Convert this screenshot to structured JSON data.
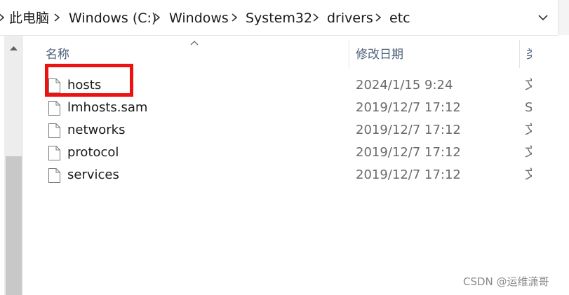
{
  "breadcrumb": [
    {
      "label": "此电脑"
    },
    {
      "label": "Windows (C:)"
    },
    {
      "label": "Windows"
    },
    {
      "label": "System32"
    },
    {
      "label": "drivers"
    },
    {
      "label": "etc"
    }
  ],
  "columns": {
    "name": "名称",
    "date_modified": "修改日期",
    "type": "类型"
  },
  "files": [
    {
      "name": "hosts",
      "date": "2024/1/15 9:24",
      "type": "文件"
    },
    {
      "name": "lmhosts.sam",
      "date": "2019/12/7 17:12",
      "type": "SAM 文件"
    },
    {
      "name": "networks",
      "date": "2019/12/7 17:12",
      "type": "文件"
    },
    {
      "name": "protocol",
      "date": "2019/12/7 17:12",
      "type": "文件"
    },
    {
      "name": "services",
      "date": "2019/12/7 17:12",
      "type": "文件"
    }
  ],
  "highlight": {
    "target": "hosts",
    "color": "#ee1111"
  },
  "watermark": "CSDN @运维潇哥",
  "icons": {
    "separator": "chevron-right-icon",
    "dropdown": "chevron-down-icon",
    "sort": "sort-ascending-icon",
    "file": "file-icon",
    "scroll_up": "scroll-up-arrow-icon"
  },
  "colors": {
    "header_text": "#4c607a",
    "highlight": "#ee1111",
    "scrollbar_thumb": "#c8c8c8"
  }
}
